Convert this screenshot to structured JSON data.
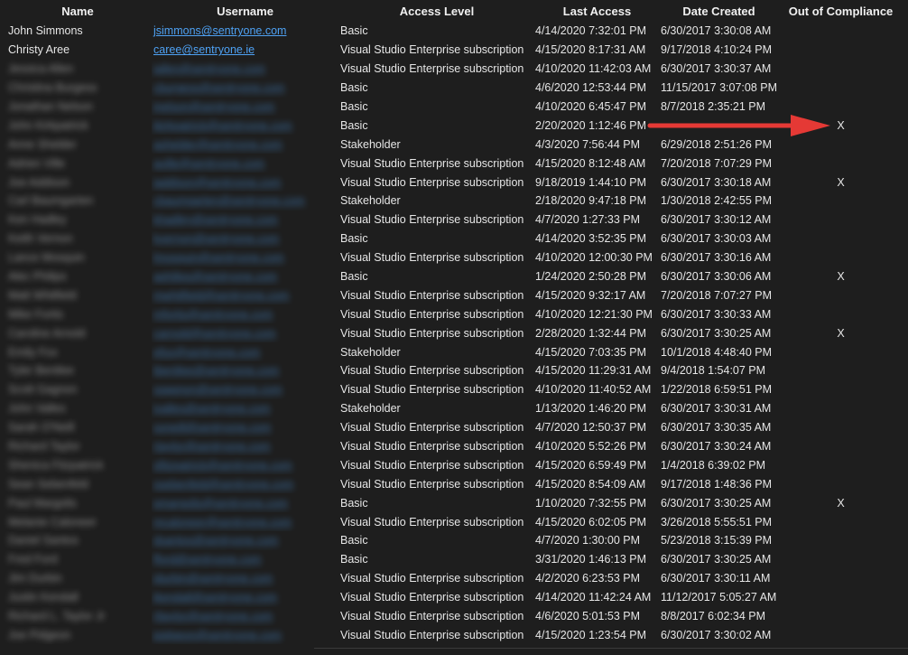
{
  "columns": [
    "Name",
    "Username",
    "Access Level",
    "Last Access",
    "Date Created",
    "Out of Compliance"
  ],
  "rows": [
    {
      "name": "John Simmons",
      "user": "jsimmons@sentryone.com",
      "access": "Basic",
      "last": "4/14/2020 7:32:01 PM",
      "created": "6/30/2017 3:30:08 AM",
      "oc": "",
      "blurred": false
    },
    {
      "name": "Christy Aree",
      "user": "caree@sentryone.ie",
      "access": "Visual Studio Enterprise subscription",
      "last": "4/15/2020 8:17:31 AM",
      "created": "9/17/2018 4:10:24 PM",
      "oc": "",
      "blurred": false
    },
    {
      "name": "Jessica Allen",
      "user": "jallen@sentryone.com",
      "access": "Visual Studio Enterprise subscription",
      "last": "4/10/2020 11:42:03 AM",
      "created": "6/30/2017 3:30:37 AM",
      "oc": "",
      "blurred": true
    },
    {
      "name": "Christina Burgess",
      "user": "cburgess@sentryone.com",
      "access": "Basic",
      "last": "4/6/2020 12:53:44 PM",
      "created": "11/15/2017 3:07:08 PM",
      "oc": "",
      "blurred": true
    },
    {
      "name": "Jonathan Nelson",
      "user": "jnelson@sentryone.com",
      "access": "Basic",
      "last": "4/10/2020 6:45:47 PM",
      "created": "8/7/2018 2:35:21 PM",
      "oc": "",
      "blurred": true
    },
    {
      "name": "John Kirkpatrick",
      "user": "jkirkpatrick@sentryone.com",
      "access": "Basic",
      "last": "2/20/2020 1:12:46 PM",
      "created": "",
      "oc": "X",
      "blurred": true
    },
    {
      "name": "Anne Shelder",
      "user": "ashelder@sentryone.com",
      "access": "Stakeholder",
      "last": "4/3/2020 7:56:44 PM",
      "created": "6/29/2018 2:51:26 PM",
      "oc": "",
      "blurred": true
    },
    {
      "name": "Adrien Ville",
      "user": "aville@sentryone.com",
      "access": "Visual Studio Enterprise subscription",
      "last": "4/15/2020 8:12:48 AM",
      "created": "7/20/2018 7:07:29 PM",
      "oc": "",
      "blurred": true
    },
    {
      "name": "Joe Addison",
      "user": "jaddison@sentryone.com",
      "access": "Visual Studio Enterprise subscription",
      "last": "9/18/2019 1:44:10 PM",
      "created": "6/30/2017 3:30:18 AM",
      "oc": "X",
      "blurred": true
    },
    {
      "name": "Carl Baumgarten",
      "user": "cbaumgarten@sentryone.com",
      "access": "Stakeholder",
      "last": "2/18/2020 9:47:18 PM",
      "created": "1/30/2018 2:42:55 PM",
      "oc": "",
      "blurred": true
    },
    {
      "name": "Ken Hadley",
      "user": "khadley@sentryone.com",
      "access": "Visual Studio Enterprise subscription",
      "last": "4/7/2020 1:27:33 PM",
      "created": "6/30/2017 3:30:12 AM",
      "oc": "",
      "blurred": true
    },
    {
      "name": "Keith Vernon",
      "user": "kvernon@sentryone.com",
      "access": "Basic",
      "last": "4/14/2020 3:52:35 PM",
      "created": "6/30/2017 3:30:03 AM",
      "oc": "",
      "blurred": true
    },
    {
      "name": "Lance Mosquin",
      "user": "lmosquin@sentryone.com",
      "access": "Visual Studio Enterprise subscription",
      "last": "4/10/2020 12:00:30 PM",
      "created": "6/30/2017 3:30:16 AM",
      "oc": "",
      "blurred": true
    },
    {
      "name": "Alec Philips",
      "user": "aphilips@sentryone.com",
      "access": "Basic",
      "last": "1/24/2020 2:50:28 PM",
      "created": "6/30/2017 3:30:06 AM",
      "oc": "X",
      "blurred": true
    },
    {
      "name": "Matt Whitfield",
      "user": "mwhitfield@sentryone.com",
      "access": "Visual Studio Enterprise subscription",
      "last": "4/15/2020 9:32:17 AM",
      "created": "7/20/2018 7:07:27 PM",
      "oc": "",
      "blurred": true
    },
    {
      "name": "Mike Fortis",
      "user": "mfortis@sentryone.com",
      "access": "Visual Studio Enterprise subscription",
      "last": "4/10/2020 12:21:30 PM",
      "created": "6/30/2017 3:30:33 AM",
      "oc": "",
      "blurred": true
    },
    {
      "name": "Caroline Arnold",
      "user": "carnold@sentryone.com",
      "access": "Visual Studio Enterprise subscription",
      "last": "2/28/2020 1:32:44 PM",
      "created": "6/30/2017 3:30:25 AM",
      "oc": "X",
      "blurred": true
    },
    {
      "name": "Emily Fox",
      "user": "efox@sentryone.com",
      "access": "Stakeholder",
      "last": "4/15/2020 7:03:35 PM",
      "created": "10/1/2018 4:48:40 PM",
      "oc": "",
      "blurred": true
    },
    {
      "name": "Tyler Bentlee",
      "user": "tbentlee@sentryone.com",
      "access": "Visual Studio Enterprise subscription",
      "last": "4/15/2020 11:29:31 AM",
      "created": "9/4/2018 1:54:07 PM",
      "oc": "",
      "blurred": true
    },
    {
      "name": "Scott Gagnon",
      "user": "sgagnon@sentryone.com",
      "access": "Visual Studio Enterprise subscription",
      "last": "4/10/2020 11:40:52 AM",
      "created": "1/22/2018 6:59:51 PM",
      "oc": "",
      "blurred": true
    },
    {
      "name": "John Valles",
      "user": "jvalles@sentryone.com",
      "access": "Stakeholder",
      "last": "1/13/2020 1:46:20 PM",
      "created": "6/30/2017 3:30:31 AM",
      "oc": "",
      "blurred": true
    },
    {
      "name": "Sarah O'Neill",
      "user": "soneill@sentryone.com",
      "access": "Visual Studio Enterprise subscription",
      "last": "4/7/2020 12:50:37 PM",
      "created": "6/30/2017 3:30:35 AM",
      "oc": "",
      "blurred": true
    },
    {
      "name": "Richard Taylor",
      "user": "rtaylor@sentryone.com",
      "access": "Visual Studio Enterprise subscription",
      "last": "4/10/2020 5:52:26 PM",
      "created": "6/30/2017 3:30:24 AM",
      "oc": "",
      "blurred": true
    },
    {
      "name": "Shenica Fitzpatrick",
      "user": "sfitzpatrick@sentryone.com",
      "access": "Visual Studio Enterprise subscription",
      "last": "4/15/2020 6:59:49 PM",
      "created": "1/4/2018 6:39:02 PM",
      "oc": "",
      "blurred": true
    },
    {
      "name": "Sean Sebenfeld",
      "user": "ssebenfeld@sentryone.com",
      "access": "Visual Studio Enterprise subscription",
      "last": "4/15/2020 8:54:09 AM",
      "created": "9/17/2018 1:48:36 PM",
      "oc": "",
      "blurred": true
    },
    {
      "name": "Paul Margolis",
      "user": "pmargolis@sentryone.com",
      "access": "Basic",
      "last": "1/10/2020 7:32:55 PM",
      "created": "6/30/2017 3:30:25 AM",
      "oc": "X",
      "blurred": true
    },
    {
      "name": "Melanie Caloneer",
      "user": "mcaloneer@sentryone.com",
      "access": "Visual Studio Enterprise subscription",
      "last": "4/15/2020 6:02:05 PM",
      "created": "3/26/2018 5:55:51 PM",
      "oc": "",
      "blurred": true
    },
    {
      "name": "Daniel Santos",
      "user": "dsantos@sentryone.com",
      "access": "Basic",
      "last": "4/7/2020 1:30:00 PM",
      "created": "5/23/2018 3:15:39 PM",
      "oc": "",
      "blurred": true
    },
    {
      "name": "Fred Ford",
      "user": "fford@sentryone.com",
      "access": "Basic",
      "last": "3/31/2020 1:46:13 PM",
      "created": "6/30/2017 3:30:25 AM",
      "oc": "",
      "blurred": true
    },
    {
      "name": "Jim Durbin",
      "user": "jdurbin@sentryone.com",
      "access": "Visual Studio Enterprise subscription",
      "last": "4/2/2020 6:23:53 PM",
      "created": "6/30/2017 3:30:11 AM",
      "oc": "",
      "blurred": true
    },
    {
      "name": "Justin Kendall",
      "user": "jkendall@sentryone.com",
      "access": "Visual Studio Enterprise subscription",
      "last": "4/14/2020 11:42:24 AM",
      "created": "11/12/2017 5:05:27 AM",
      "oc": "",
      "blurred": true
    },
    {
      "name": "Richard L. Taylor Jr",
      "user": "rltaylor@sentryone.com",
      "access": "Visual Studio Enterprise subscription",
      "last": "4/6/2020 5:01:53 PM",
      "created": "8/8/2017 6:02:34 PM",
      "oc": "",
      "blurred": true
    },
    {
      "name": "Joe Pidgeon",
      "user": "jpidgeon@sentryone.com",
      "access": "Visual Studio Enterprise subscription",
      "last": "4/15/2020 1:23:54 PM",
      "created": "6/30/2017 3:30:02 AM",
      "oc": "",
      "blurred": true
    }
  ],
  "colors": {
    "background": "#1e1e1e",
    "text": "#e6e6e6",
    "link": "#4ea1f3",
    "arrow": "#e53935"
  },
  "annotation_icon": "red-arrow-icon"
}
